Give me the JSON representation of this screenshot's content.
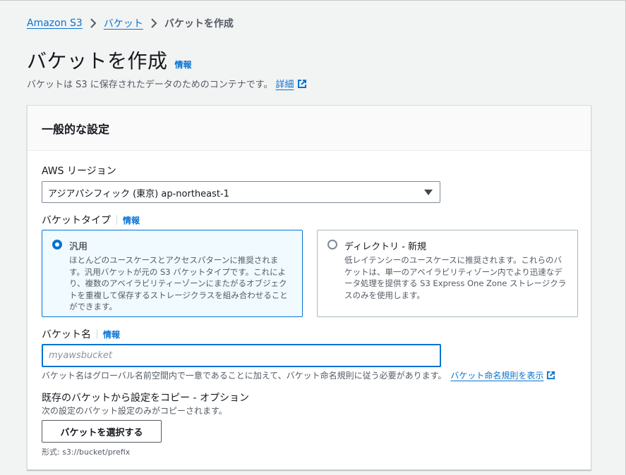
{
  "breadcrumb": {
    "items": [
      "Amazon S3",
      "バケット"
    ],
    "current": "バケットを作成"
  },
  "page": {
    "title": "バケットを作成",
    "info": "情報",
    "description": "バケットは S3 に保存されたデータのためのコンテナです。",
    "learn_more": "詳細"
  },
  "panel": {
    "header": "一般的な設定",
    "region": {
      "label": "AWS リージョン",
      "value": "アジアパシフィック (東京) ap-northeast-1"
    },
    "bucket_type": {
      "label": "バケットタイプ",
      "info": "情報",
      "options": [
        {
          "title": "汎用",
          "description": "ほとんどのユースケースとアクセスパターンに推奨されます。汎用バケットが元の S3 バケットタイプです。これにより、複数のアベイラビリティーゾーンにまたがるオブジェクトを重複して保存するストレージクラスを組み合わせることができます。",
          "selected": true
        },
        {
          "title": "ディレクトリ - 新規",
          "description": "低レイテンシーのユースケースに推奨されます。これらのバケットは、単一のアベイラビリティゾーン内でより迅速なデータ処理を提供する S3 Express One Zone ストレージクラスのみを使用します。",
          "selected": false
        }
      ]
    },
    "bucket_name": {
      "label": "バケット名",
      "info": "情報",
      "placeholder": "myawsbucket",
      "value": "",
      "hint": "バケット名はグローバル名前空間内で一意であることに加えて、バケット命名規則に従う必要があります。",
      "rules_link": "バケット命名規則を表示"
    },
    "copy_settings": {
      "label": "既存のバケットから設定をコピー - オプション",
      "description": "次の設定のバケット設定のみがコピーされます。",
      "button": "バケットを選択する",
      "format": "形式: s3://bucket/prefix"
    }
  },
  "colors": {
    "link": "#0972d3",
    "selected_border": "#0972d3",
    "selected_bg": "#f1faff",
    "text": "#16191f",
    "muted": "#545b64"
  }
}
